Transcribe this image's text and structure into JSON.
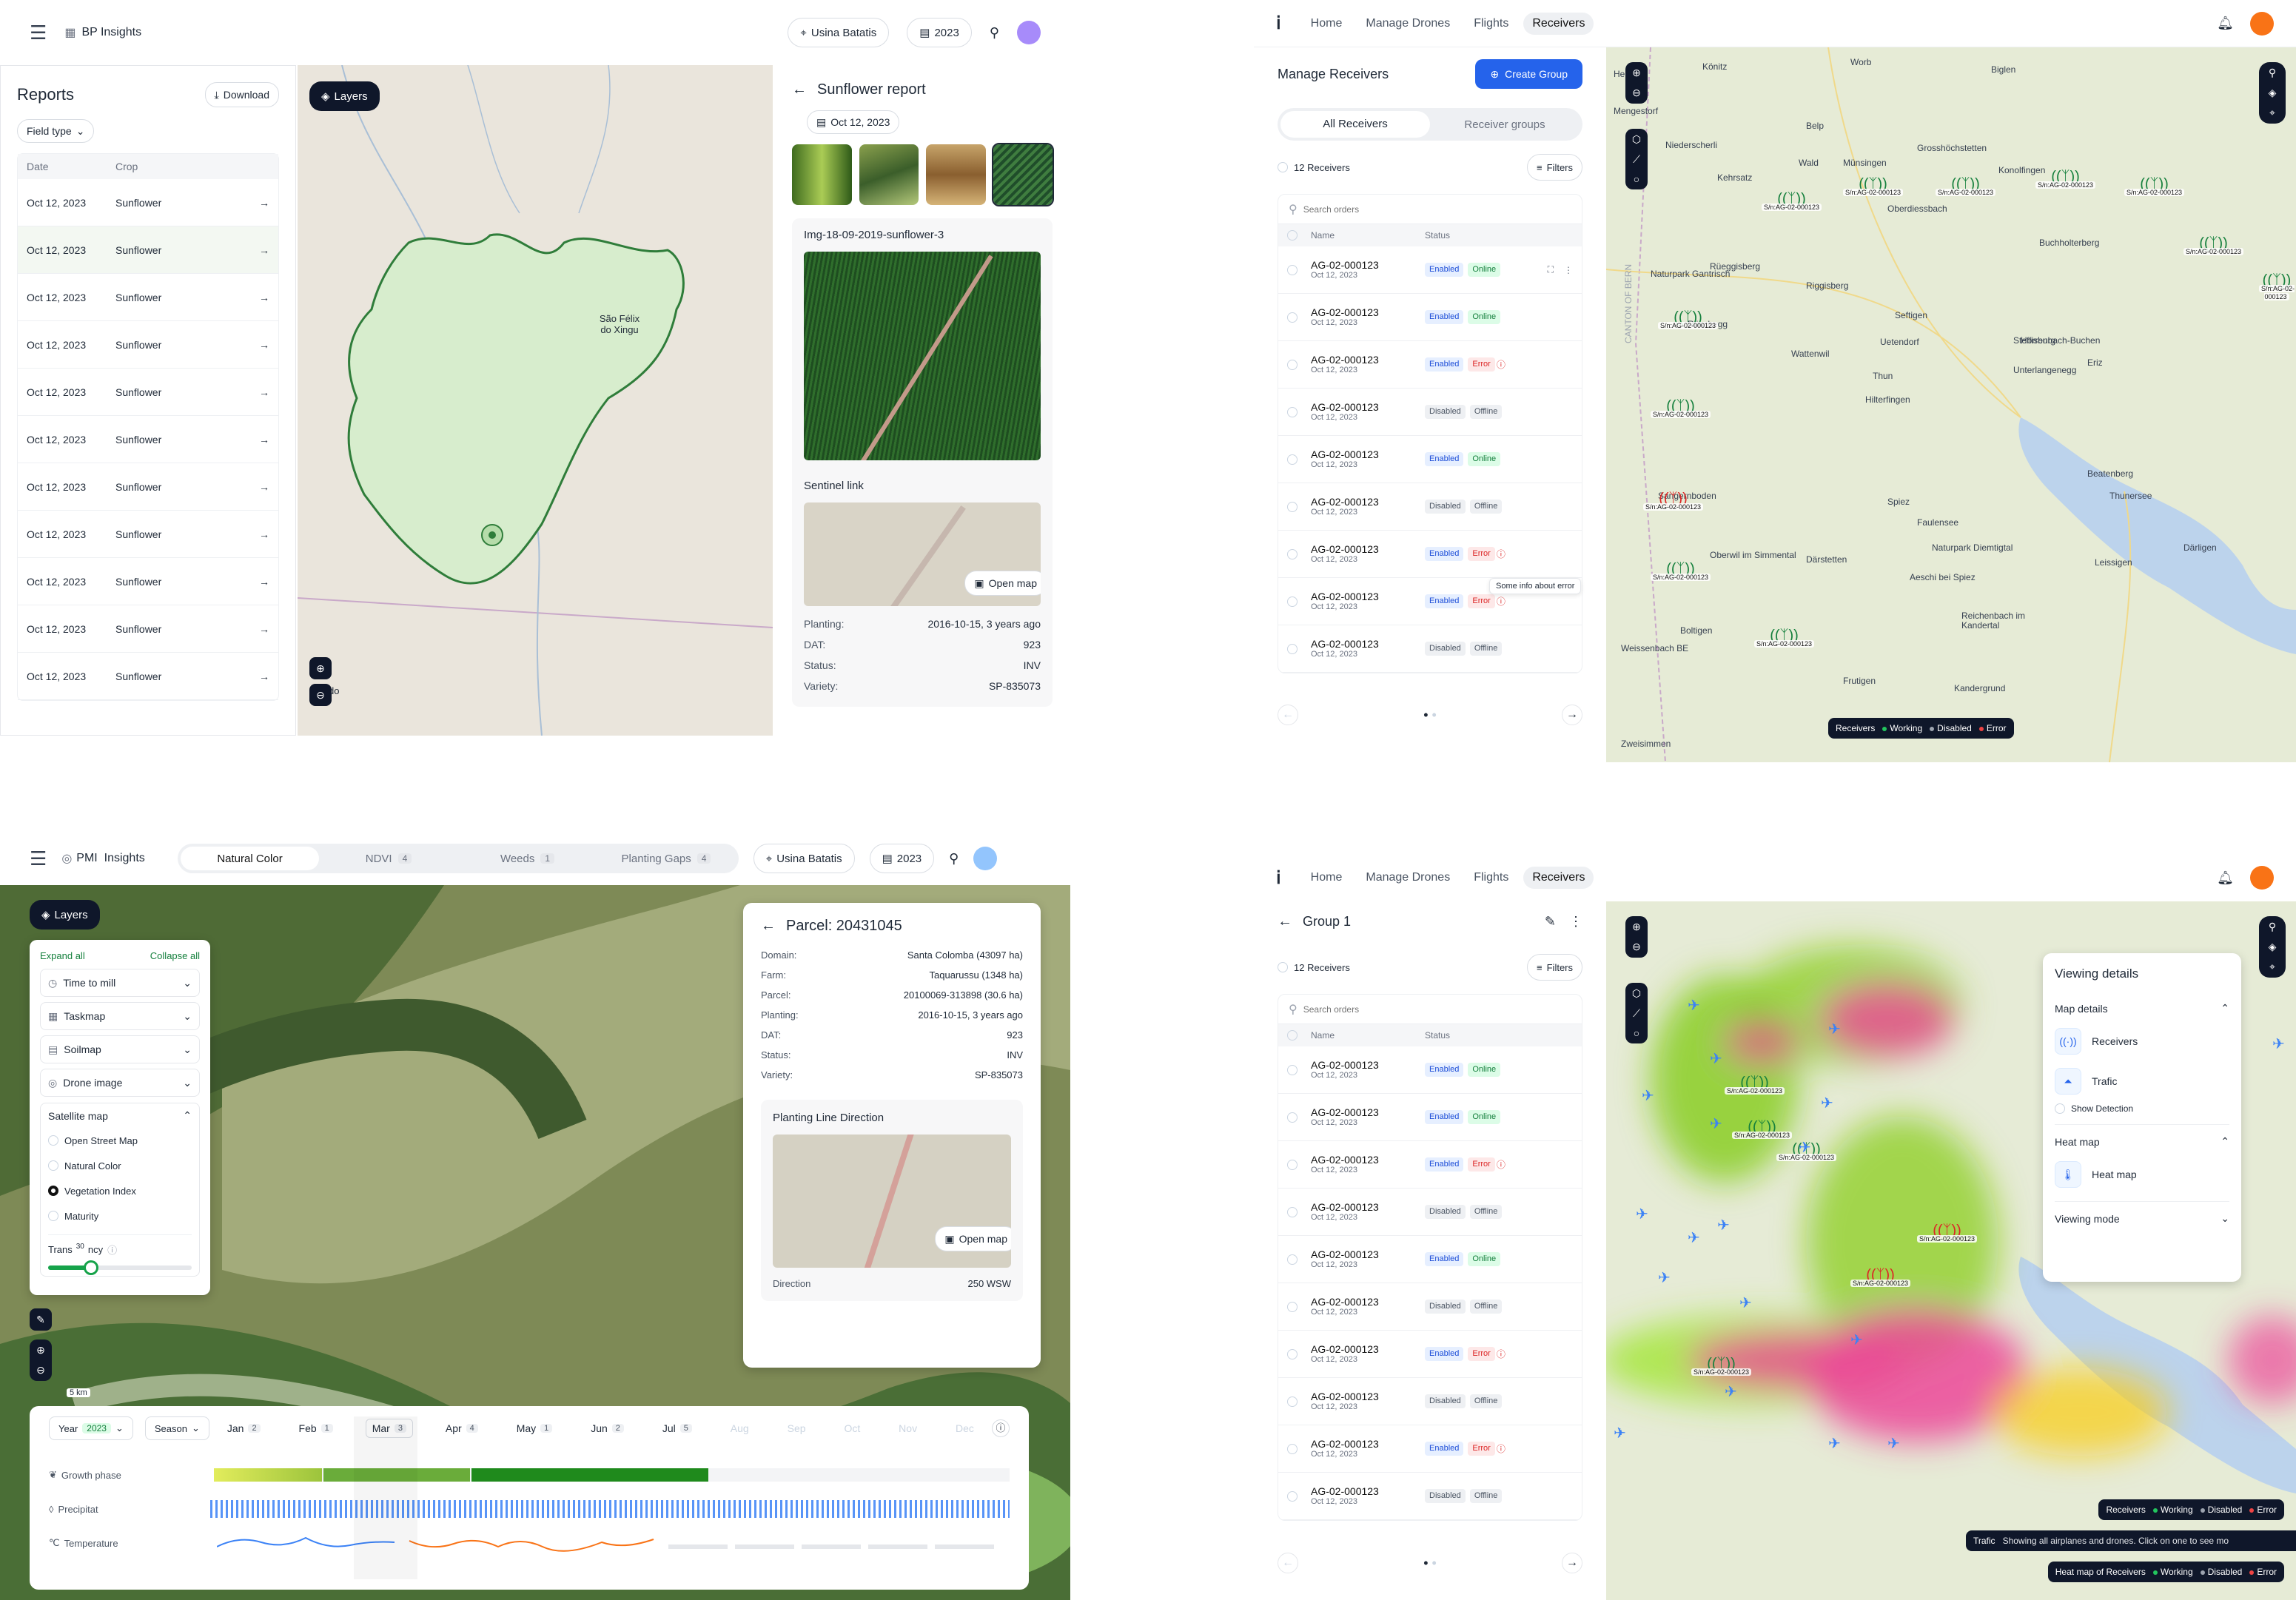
{
  "q1": {
    "header": {
      "app_name": "BP Insights",
      "location": "Usina Batatis",
      "year": "2023"
    },
    "reports": {
      "title": "Reports",
      "download": "Download",
      "field_type": "Field type",
      "col_date": "Date",
      "col_crop": "Crop",
      "rows": [
        {
          "date": "Oct 12, 2023",
          "crop": "Sunflower"
        },
        {
          "date": "Oct 12, 2023",
          "crop": "Sunflower"
        },
        {
          "date": "Oct 12, 2023",
          "crop": "Sunflower"
        },
        {
          "date": "Oct 12, 2023",
          "crop": "Sunflower"
        },
        {
          "date": "Oct 12, 2023",
          "crop": "Sunflower"
        },
        {
          "date": "Oct 12, 2023",
          "crop": "Sunflower"
        },
        {
          "date": "Oct 12, 2023",
          "crop": "Sunflower"
        },
        {
          "date": "Oct 12, 2023",
          "crop": "Sunflower"
        },
        {
          "date": "Oct 12, 2023",
          "crop": "Sunflower"
        },
        {
          "date": "Oct 12, 2023",
          "crop": "Sunflower"
        },
        {
          "date": "Oct 12, 2023",
          "crop": "Sunflower"
        }
      ]
    },
    "map": {
      "layers": "Layers",
      "city": "São Félix do Xingu",
      "city2": "do"
    },
    "detail": {
      "title": "Sunflower report",
      "date": "Oct 12, 2023",
      "image_name": "Img-18-09-2019-sunflower-3",
      "sentinel": "Sentinel link",
      "open_map": "Open map",
      "fields": [
        {
          "k": "Planting:",
          "v": "2016-10-15, 3 years ago"
        },
        {
          "k": "DAT:",
          "v": "923"
        },
        {
          "k": "Status:",
          "v": "INV"
        },
        {
          "k": "Variety:",
          "v": "SP-835073"
        }
      ]
    }
  },
  "q2": {
    "nav": [
      "Home",
      "Manage Drones",
      "Flights",
      "Receivers"
    ],
    "title": "Manage Receivers",
    "create_group": "Create Group",
    "tabs": [
      "All Receivers",
      "Receiver groups"
    ],
    "count": "12 Receivers",
    "filters": "Filters",
    "search_placeholder": "Search orders",
    "col_name": "Name",
    "col_status": "Status",
    "tooltip": "Some info about error",
    "rows": [
      {
        "id": "AG-02-000123",
        "date": "Oct 12, 2023",
        "en": "Enabled",
        "st": "Online"
      },
      {
        "id": "AG-02-000123",
        "date": "Oct 12, 2023",
        "en": "Enabled",
        "st": "Online"
      },
      {
        "id": "AG-02-000123",
        "date": "Oct 12, 2023",
        "en": "Enabled",
        "st": "Error"
      },
      {
        "id": "AG-02-000123",
        "date": "Oct 12, 2023",
        "en": "Disabled",
        "st": "Offline"
      },
      {
        "id": "AG-02-000123",
        "date": "Oct 12, 2023",
        "en": "Enabled",
        "st": "Online"
      },
      {
        "id": "AG-02-000123",
        "date": "Oct 12, 2023",
        "en": "Disabled",
        "st": "Offline"
      },
      {
        "id": "AG-02-000123",
        "date": "Oct 12, 2023",
        "en": "Enabled",
        "st": "Error"
      },
      {
        "id": "AG-02-000123",
        "date": "Oct 12, 2023",
        "en": "Enabled",
        "st": "Error"
      },
      {
        "id": "AG-02-000123",
        "date": "Oct 12, 2023",
        "en": "Disabled",
        "st": "Offline"
      }
    ],
    "legend": {
      "title": "Receivers",
      "working": "Working",
      "disabled": "Disabled",
      "error": "Error"
    },
    "places": [
      "Herzwil",
      "Könitz",
      "Worb",
      "Biglen",
      "Mengestorf",
      "Niederscherli",
      "Belp",
      "Wald",
      "Grosshöchstetten",
      "Kehrsatz",
      "Münsingen",
      "Konolfingen",
      "Rüeggisberg",
      "Oberdiessbach",
      "Buchholterberg",
      "Riggisberg",
      "Rüschegg",
      "Seftigen",
      "Uetendorf",
      "Steffisburg",
      "Wattenwil",
      "Unterlangenegg",
      "Horrenbach-Buchen",
      "Thun",
      "Hilterfingen",
      "Sangernboden",
      "Spiez",
      "Faulensee",
      "Oberwil im Simmental",
      "Därstetten",
      "Aeschi bei Spiez",
      "Boltigen",
      "Reichenbach im Kandertal",
      "Weissenbach BE",
      "Frutigen",
      "Kandergrund",
      "Zweisimmen",
      "Beatenberg",
      "Leissigen",
      "Därligen",
      "Naturpark Gantrisch",
      "Naturpark Diemtigtal",
      "CANTON OF BERN",
      "Eriz",
      "Thunersee"
    ],
    "receiver_label": "S/n:AG-02-000123"
  },
  "q3": {
    "header": {
      "app_name": "PMI  Insights",
      "location": "Usina Batatis",
      "year": "2023"
    },
    "tabs": [
      {
        "label": "Natural Color",
        "count": ""
      },
      {
        "label": "NDVI",
        "count": "4"
      },
      {
        "label": "Weeds",
        "count": "1"
      },
      {
        "label": "Planting Gaps",
        "count": "4"
      }
    ],
    "layers": {
      "button": "Layers",
      "expand": "Expand all",
      "collapse": "Collapse all",
      "items": [
        "Time to mill",
        "Taskmap",
        "Soilmap",
        "Drone image"
      ],
      "satellite": "Satellite map",
      "options": [
        "Open Street Map",
        "Natural Color",
        "Vegetation Index",
        "Maturity"
      ],
      "transparency_a": "Trans",
      "transparency_b": "ncy",
      "transparency_value": "30",
      "transparency_fraction": 0.3
    },
    "scale": "5 km",
    "parcel": {
      "title": "Parcel: 20431045",
      "fields": [
        {
          "k": "Domain:",
          "v": "Santa Colomba (43097 ha)"
        },
        {
          "k": "Farm:",
          "v": "Taquarussu (1348 ha)"
        },
        {
          "k": "Parcel:",
          "v": "20100069-313898 (30.6 ha)"
        },
        {
          "k": "Planting:",
          "v": "2016-10-15, 3 years ago"
        },
        {
          "k": "DAT:",
          "v": "923"
        },
        {
          "k": "Status:",
          "v": "INV"
        },
        {
          "k": "Variety:",
          "v": "SP-835073"
        }
      ],
      "pld": "Planting Line Direction",
      "open_map": "Open map",
      "direction_label": "Direction",
      "direction_value": "250 WSW"
    },
    "timeline": {
      "year_label": "Year",
      "year_value": "2023",
      "season": "Season",
      "months": [
        {
          "m": "Jan",
          "c": "2"
        },
        {
          "m": "Feb",
          "c": "1"
        },
        {
          "m": "Mar",
          "c": "3"
        },
        {
          "m": "Apr",
          "c": "4"
        },
        {
          "m": "May",
          "c": "1"
        },
        {
          "m": "Jun",
          "c": "2"
        },
        {
          "m": "Jul",
          "c": "5"
        },
        {
          "m": "Aug",
          "c": ""
        },
        {
          "m": "Sep",
          "c": ""
        },
        {
          "m": "Oct",
          "c": ""
        },
        {
          "m": "Nov",
          "c": ""
        },
        {
          "m": "Dec",
          "c": ""
        }
      ],
      "rows": [
        "Growth phase",
        "Precipitat",
        "Temperature"
      ]
    }
  },
  "q4": {
    "nav": [
      "Home",
      "Manage Drones",
      "Flights",
      "Receivers"
    ],
    "title": "Group 1",
    "count": "12 Receivers",
    "filters": "Filters",
    "search_placeholder": "Search orders",
    "col_name": "Name",
    "col_status": "Status",
    "rows": [
      {
        "id": "AG-02-000123",
        "date": "Oct 12, 2023",
        "en": "Enabled",
        "st": "Online"
      },
      {
        "id": "AG-02-000123",
        "date": "Oct 12, 2023",
        "en": "Enabled",
        "st": "Online"
      },
      {
        "id": "AG-02-000123",
        "date": "Oct 12, 2023",
        "en": "Enabled",
        "st": "Error"
      },
      {
        "id": "AG-02-000123",
        "date": "Oct 12, 2023",
        "en": "Disabled",
        "st": "Offline"
      },
      {
        "id": "AG-02-000123",
        "date": "Oct 12, 2023",
        "en": "Enabled",
        "st": "Online"
      },
      {
        "id": "AG-02-000123",
        "date": "Oct 12, 2023",
        "en": "Disabled",
        "st": "Offline"
      },
      {
        "id": "AG-02-000123",
        "date": "Oct 12, 2023",
        "en": "Enabled",
        "st": "Error"
      },
      {
        "id": "AG-02-000123",
        "date": "Oct 12, 2023",
        "en": "Disabled",
        "st": "Offline"
      },
      {
        "id": "AG-02-000123",
        "date": "Oct 12, 2023",
        "en": "Enabled",
        "st": "Error"
      },
      {
        "id": "AG-02-000123",
        "date": "Oct 12, 2023",
        "en": "Disabled",
        "st": "Offline"
      }
    ],
    "details": {
      "title": "Viewing details",
      "map_details": "Map details",
      "receivers": "Receivers",
      "traffic": "Trafic",
      "show_detection": "Show Detection",
      "heat_map_section": "Heat map",
      "heat_map": "Heat map",
      "viewing_mode": "Viewing mode"
    },
    "legend1": {
      "title": "Receivers",
      "working": "Working",
      "disabled": "Disabled",
      "error": "Error"
    },
    "legend2": {
      "title": "Trafic",
      "text": "Showing all airplanes and drones. Click on one to see mo"
    },
    "legend3": {
      "title": "Heat map of Receivers",
      "working": "Working",
      "disabled": "Disabled",
      "error": "Error"
    },
    "receiver_label": "S/n:AG-02-000123"
  },
  "colors": {
    "accent_blue": "#2563eb",
    "green": "#16a34a",
    "error": "#dc2626",
    "dark": "#0f172a"
  }
}
